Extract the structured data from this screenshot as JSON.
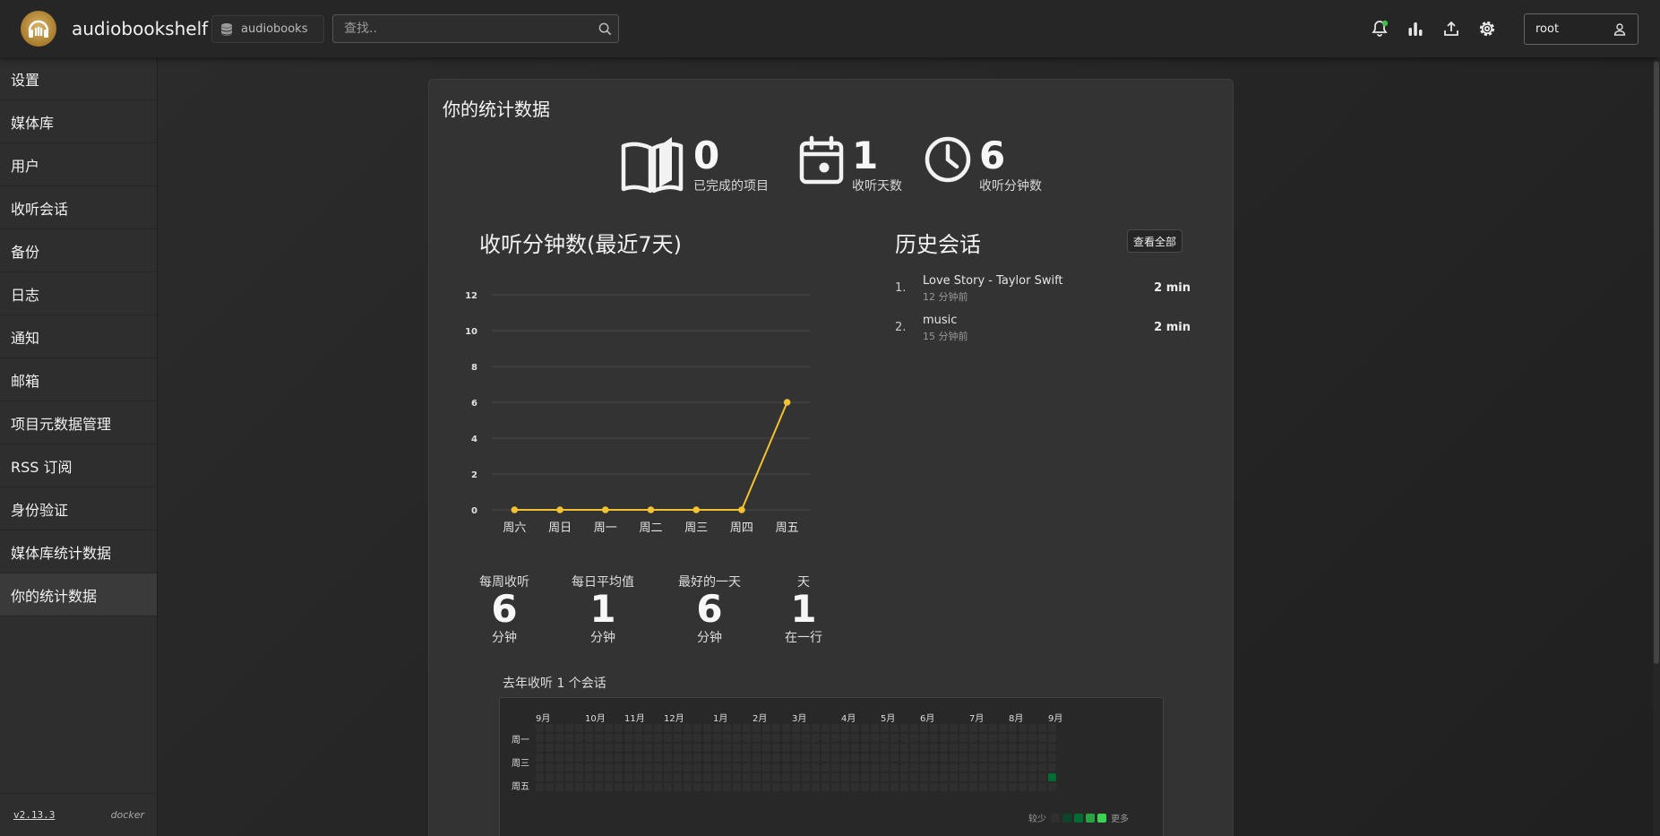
{
  "header": {
    "app_name": "audiobookshelf",
    "library": "audiobooks",
    "search_placeholder": "查找..",
    "user": "root"
  },
  "sidebar": {
    "items": [
      "设置",
      "媒体库",
      "用户",
      "收听会话",
      "备份",
      "日志",
      "通知",
      "邮箱",
      "项目元数据管理",
      "RSS 订阅",
      "身份验证",
      "媒体库统计数据",
      "你的统计数据"
    ],
    "active_index": 12,
    "version": "v2.13.3",
    "install": "docker"
  },
  "page": {
    "title": "你的统计数据",
    "stats": [
      {
        "icon": "open-book-icon",
        "value": "0",
        "label": "已完成的项目"
      },
      {
        "icon": "calendar-icon",
        "value": "1",
        "label": "收听天数"
      },
      {
        "icon": "clock-icon",
        "value": "6",
        "label": "收听分钟数"
      }
    ],
    "chart_title": "收听分钟数(最近7天)",
    "history_title": "历史会话",
    "view_all": "查看全部",
    "history": [
      {
        "index": "1.",
        "title": "Love Story - Taylor Swift",
        "time": "12 分钟前",
        "duration": "2 min"
      },
      {
        "index": "2.",
        "title": "music",
        "time": "15 分钟前",
        "duration": "2 min"
      }
    ],
    "summary": [
      {
        "title": "每周收听",
        "value": "6",
        "unit": "分钟"
      },
      {
        "title": "每日平均值",
        "value": "1",
        "unit": "分钟"
      },
      {
        "title": "最好的一天",
        "value": "6",
        "unit": "分钟"
      },
      {
        "title": "天",
        "value": "1",
        "unit": "在一行"
      }
    ],
    "heatmap": {
      "title": "去年收听 1 个会话",
      "months": [
        "9月",
        "10月",
        "11月",
        "12月",
        "1月",
        "2月",
        "3月",
        "4月",
        "5月",
        "6月",
        "7月",
        "8月",
        "9月"
      ],
      "weekdays": [
        "周一",
        "周三",
        "周五"
      ],
      "legend_less": "较少",
      "legend_more": "更多",
      "active_cell": {
        "week_index": 52,
        "weekday_row": 5,
        "level": 2
      }
    }
  },
  "colors": {
    "accent_line": "#f2c230",
    "heat_empty": "#2f2f2f",
    "heat_levels": [
      "#0e4429",
      "#006d32",
      "#26a641",
      "#39d353"
    ]
  },
  "chart_data": {
    "type": "line",
    "categories": [
      "周六",
      "周日",
      "周一",
      "周二",
      "周三",
      "周四",
      "周五"
    ],
    "values": [
      0,
      0,
      0,
      0,
      0,
      0,
      6
    ],
    "title": "收听分钟数(最近7天)",
    "ylim": [
      0,
      12
    ],
    "yticks": [
      0,
      2,
      4,
      6,
      8,
      10,
      12
    ],
    "grid": true
  }
}
